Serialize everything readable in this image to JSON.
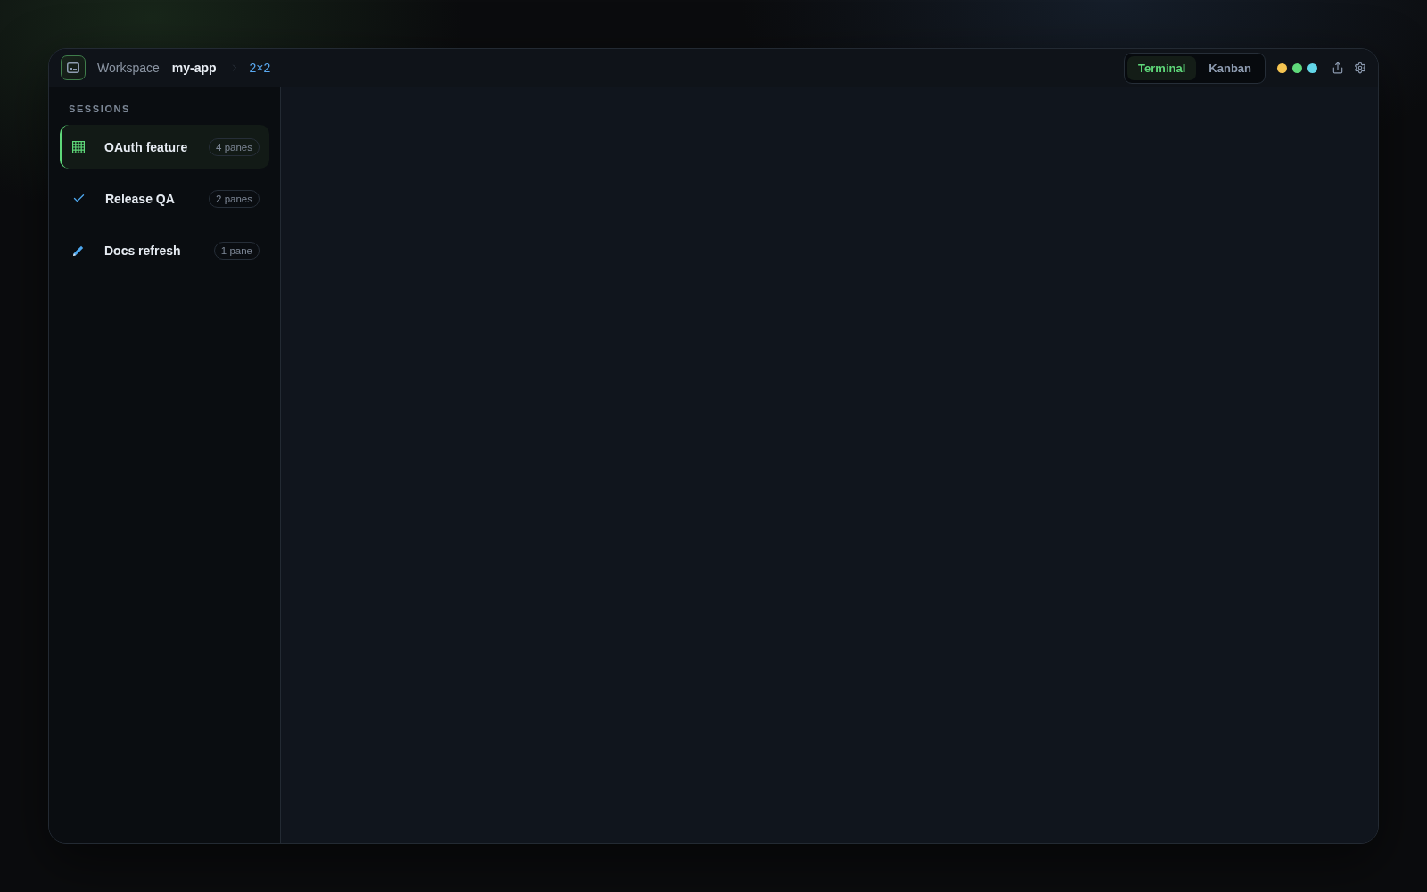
{
  "header": {
    "workspace_label": "Workspace",
    "project": "my-app",
    "layout": "2×2",
    "view_switch": [
      {
        "label": "Terminal",
        "selected": true
      },
      {
        "label": "Kanban",
        "selected": false
      }
    ],
    "status_dots": [
      {
        "color": "#f5c451"
      },
      {
        "color": "#5fd97a"
      },
      {
        "color": "#62d6e8"
      }
    ]
  },
  "sidebar": {
    "title": "SESSIONS",
    "sessions": [
      {
        "name": "OAuth feature",
        "panes": "4 panes",
        "selected": true
      },
      {
        "name": "Release QA",
        "panes": "2 panes",
        "selected": false
      },
      {
        "name": "Docs refresh",
        "panes": "1 pane",
        "selected": false
      }
    ]
  }
}
